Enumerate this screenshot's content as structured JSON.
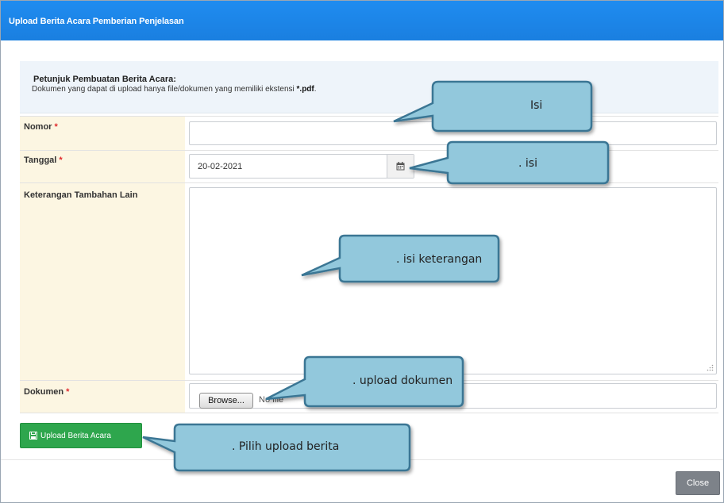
{
  "modal": {
    "title": "Upload Berita Acara Pemberian Penjelasan"
  },
  "info": {
    "title": "Petunjuk Pembuatan Berita Acara:",
    "text": "Dokumen yang dapat di upload hanya file/dokumen yang memiliki ekstensi ",
    "ext": "*.pdf",
    "end": "."
  },
  "form": {
    "nomor_label": "Nomor",
    "nomor_value": "",
    "tanggal_label": "Tanggal",
    "tanggal_value": "20-02-2021",
    "keterangan_label": "Keterangan Tambahan Lain",
    "keterangan_value": "",
    "dokumen_label": "Dokumen",
    "browse_label": "Browse...",
    "nofile_text": "No file",
    "required_mark": "*"
  },
  "actions": {
    "upload_label": "Upload Berita Acara",
    "close_label": "Close"
  },
  "callouts": {
    "isi_nomor": "Isi",
    "isi_tanggal": ". isi",
    "isi_keterangan": ". isi keterangan",
    "upload_dokumen": ". upload dokumen",
    "pilih_upload": ". Pilih upload berita"
  },
  "colors": {
    "header": "#1f8cf0",
    "upload_button": "#2ea64d",
    "callout_fill": "#92c8dc",
    "callout_border": "#3a7694",
    "required": "#e0292c",
    "label_bg": "#fcf6e2"
  },
  "icons": {
    "calendar": "calendar-icon",
    "save": "floppy-disk-icon"
  }
}
